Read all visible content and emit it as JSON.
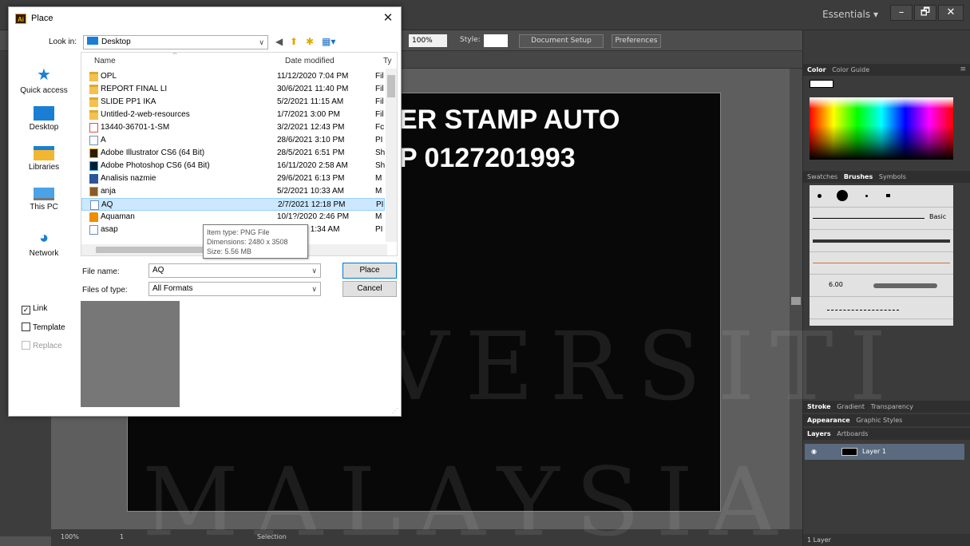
{
  "illustrator": {
    "workspace": "Essentials",
    "window_controls": [
      "–",
      "🗗",
      "✕"
    ],
    "zoom_value": "100%",
    "style_label": "Style:",
    "document_setup": "Document Setup",
    "preferences": "Preferences",
    "artboard_text": [
      "ER STAMP AUTO",
      "P 0127201993"
    ],
    "status_zoom": "100%",
    "status_page": "1",
    "status_tool": "Selection",
    "colors": {
      "chrome": "#3c3c3c",
      "canvas": "#5e5e5e",
      "artboard": "#080808"
    }
  },
  "panels": {
    "color_tabs": [
      "Color",
      "Color Guide"
    ],
    "swatch_tabs": [
      "Swatches",
      "Brushes",
      "Symbols"
    ],
    "brush_basic_label": "Basic",
    "brush_size": "6.00",
    "stroke_tabs": [
      "Stroke",
      "Gradient",
      "Transparency"
    ],
    "appearance_tabs": [
      "Appearance",
      "Graphic Styles"
    ],
    "layer_tabs": [
      "Layers",
      "Artboards"
    ],
    "layer_name": "Layer 1",
    "layers_count": "1 Layer"
  },
  "watermark": [
    "UNIVERSITI",
    "MALAYSIA"
  ],
  "dialog": {
    "title": "Place",
    "look_in_label": "Look in:",
    "look_in_value": "Desktop",
    "places": [
      "Quick access",
      "Desktop",
      "Libraries",
      "This PC",
      "Network"
    ],
    "columns": [
      "Name",
      "Date modified",
      "Ty"
    ],
    "files": [
      {
        "name": "OPL",
        "date": "11/12/2020 7:04 PM",
        "type": "Fil",
        "icon": "folder-icon"
      },
      {
        "name": "REPORT FINAL LI",
        "date": "30/6/2021 11:40 PM",
        "type": "Fil",
        "icon": "folder-icon"
      },
      {
        "name": "SLIDE PP1 IKA",
        "date": "5/2/2021 11:15 AM",
        "type": "Fil",
        "icon": "folder-icon"
      },
      {
        "name": "Untitled-2-web-resources",
        "date": "1/7/2021 3:00 PM",
        "type": "Fil",
        "icon": "folder-icon"
      },
      {
        "name": "13440-36701-1-SM",
        "date": "3/2/2021 12:43 PM",
        "type": "Fc",
        "icon": "pdf-icon"
      },
      {
        "name": "A",
        "date": "28/6/2021 3:10 PM",
        "type": "PI",
        "icon": "image-icon"
      },
      {
        "name": "Adobe Illustrator CS6 (64 Bit)",
        "date": "28/5/2021 6:51 PM",
        "type": "Sh",
        "icon": "illustrator-shortcut-icon"
      },
      {
        "name": "Adobe Photoshop CS6 (64 Bit)",
        "date": "16/11/2020 2:58 AM",
        "type": "Sh",
        "icon": "photoshop-shortcut-icon"
      },
      {
        "name": "Analisis nazmie",
        "date": "29/6/2021 6:13 PM",
        "type": "M",
        "icon": "word-icon"
      },
      {
        "name": "anja",
        "date": "5/2/2021 10:33 AM",
        "type": "M",
        "icon": "archive-icon"
      },
      {
        "name": "AQ",
        "date": "2/7/2021 12:18 PM",
        "type": "PI",
        "icon": "image-icon"
      },
      {
        "name": "Aquaman",
        "date": "10/1?/2020 2:46 PM",
        "type": "M",
        "icon": "vlc-icon"
      },
      {
        "name": "asap",
        "date": "2/?/2021 1:34 AM",
        "type": "PI",
        "icon": "image-icon"
      }
    ],
    "tooltip": [
      "Item type: PNG File",
      "Dimensions: 2480 x 3508",
      "Size: 5.56 MB"
    ],
    "file_name_label": "File name:",
    "file_name_value": "AQ",
    "files_of_type_label": "Files of type:",
    "files_of_type_value": "All Formats",
    "place_button": "Place",
    "cancel_button": "Cancel",
    "link_label": "Link",
    "template_label": "Template",
    "replace_label": "Replace",
    "link_checked": true
  }
}
